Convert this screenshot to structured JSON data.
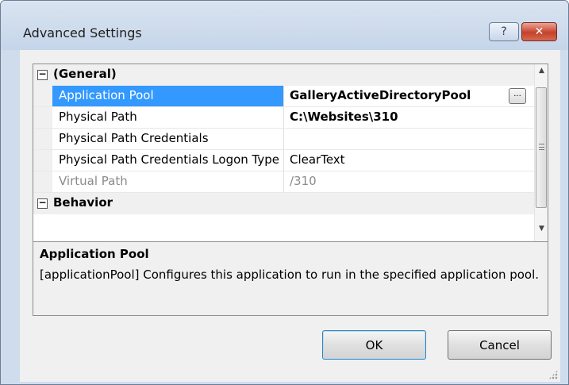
{
  "window": {
    "title": "Advanced Settings",
    "help_label": "?",
    "close_label": "✕"
  },
  "grid": {
    "categories": [
      {
        "label": "(General)",
        "toggle": "⊟"
      },
      {
        "label": "Behavior",
        "toggle": "⊟"
      }
    ],
    "properties": [
      {
        "name": "Application Pool",
        "value": "GalleryActiveDirectoryPool"
      },
      {
        "name": "Physical Path",
        "value": "C:\\Websites\\310"
      },
      {
        "name": "Physical Path Credentials",
        "value": ""
      },
      {
        "name": "Physical Path Credentials Logon Type",
        "value": "ClearText"
      },
      {
        "name": "Virtual Path",
        "value": "/310"
      }
    ],
    "ellipsis_label": "...",
    "scroll_up": "▲",
    "scroll_down": "▼"
  },
  "description": {
    "title": "Application Pool",
    "text": "[applicationPool] Configures this application to run in the specified application pool."
  },
  "buttons": {
    "ok": "OK",
    "cancel": "Cancel"
  },
  "colors": {
    "selection": "#3399ff",
    "title_bg": "#cfdcec",
    "close_button": "#c6412b"
  }
}
